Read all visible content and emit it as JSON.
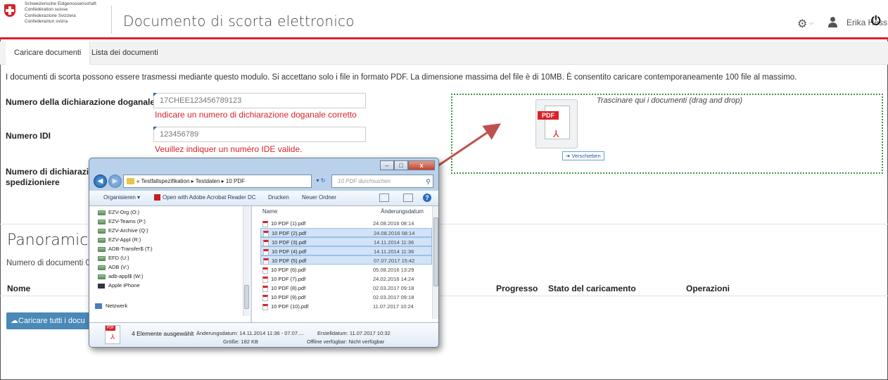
{
  "header": {
    "federation": [
      "Schweizerische Eidgenossenschaft",
      "Confédération suisse",
      "Confederazione Svizzera",
      "Confederaziun svizra"
    ],
    "title": "Documento di scorta elettronico",
    "user_name": "Erika Hess",
    "icons": {
      "settings": "gear-icon",
      "user": "user-icon",
      "logout": "power-icon"
    }
  },
  "tabs": [
    {
      "label": "Caricare documenti",
      "active": true
    },
    {
      "label": "Lista dei documenti",
      "active": false
    }
  ],
  "intro_text": "I documenti di scorta possono essere trasmessi mediante questo modulo. Si accettano solo i file in formato PDF. La dimensione massima del file è di 10MB. È consentito caricare contemporaneamente 100 file al massimo.",
  "form": {
    "declaration": {
      "label": "Numero della dichiarazione doganale",
      "value": "17CHEE123456789123",
      "error": "Indicare un numero di dichiarazione doganale corretto"
    },
    "idi": {
      "label": "Numero IDI",
      "value": "123456789",
      "error": "Veuillez indiquer un numéro IDE valide."
    },
    "forwarder": {
      "label_line1": "Numero di dichiarazion",
      "label_line2": "spedizioniere"
    }
  },
  "dropzone": {
    "text": "Trascinare qui i documenti (drag and drop)",
    "drag_icon_label": "PDF",
    "move_badge": "Verschieben"
  },
  "overview": {
    "title": "Panoramica d",
    "count_label": "Numero di documenti 0",
    "columns": {
      "name": "Nome",
      "progress": "Progresso",
      "status": "Stato del caricamento",
      "operations": "Operazioni"
    },
    "upload_all": "Caricare tutti i docu"
  },
  "explorer": {
    "window_buttons": {
      "minimize": "–",
      "maximize": "□",
      "close": "x"
    },
    "address_path": "« Testfallspezifikation ▸ Testdaten ▸ 10 PDF",
    "search_placeholder": "10 PDF durchsuchen",
    "toolbar": {
      "organize": "Organisieren ▾",
      "open_with": "Open with Adobe Acrobat Reader DC",
      "print": "Drucken",
      "new_folder": "Neuer Ordner"
    },
    "drives": [
      "EZV-Org (O:)",
      "EZV-Teams (P:)",
      "EZV-Archive (Q:)",
      "EZV-Appl (R:)",
      "ADB-Transfer$ (T:)",
      "EFD (U:)",
      "ADB (V:)",
      "adb-appl$ (W:)",
      "Apple iPhone"
    ],
    "network": "Netzwerk",
    "columns": {
      "name": "Name",
      "date": "Änderungsdatum"
    },
    "files": [
      {
        "name": "10 PDF (1).pdf",
        "date": "24.08.2016 08:14",
        "selected": false
      },
      {
        "name": "10 PDF (2).pdf",
        "date": "24.08.2016 08:14",
        "selected": true
      },
      {
        "name": "10 PDF (3).pdf",
        "date": "14.11.2014 11:36",
        "selected": true
      },
      {
        "name": "10 PDF (4).pdf",
        "date": "14.11.2014 11:36",
        "selected": true
      },
      {
        "name": "10 PDF (5).pdf",
        "date": "07.07.2017 15:42",
        "selected": true
      },
      {
        "name": "10 PDF (6).pdf",
        "date": "05.08.2016 13:29",
        "selected": false
      },
      {
        "name": "10 PDF (7).pdf",
        "date": "24.02.2016 14:24",
        "selected": false
      },
      {
        "name": "10 PDF (8).pdf",
        "date": "02.03.2017 09:18",
        "selected": false
      },
      {
        "name": "10 PDF (9).pdf",
        "date": "02.03.2017 09:18",
        "selected": false
      },
      {
        "name": "10 PDF (10).pdf",
        "date": "11.07.2017 10:24",
        "selected": false
      }
    ],
    "details": {
      "icon_label": "PDF",
      "selected": "4 Elemente ausgewählt",
      "modified": "Änderungsdatum: 14.11.2014 11:36 - 07.07....",
      "created": "Erstelldatum: 11.07.2017 10:32",
      "size": "Größe: 182 KB",
      "offline": "Offline verfügbar: Nicht verfügbar"
    }
  },
  "colors": {
    "swiss_red": "#d8232a",
    "dropzone_border": "#3c9a3c",
    "button_blue": "#4a89b8",
    "arrow": "#c0504d"
  }
}
